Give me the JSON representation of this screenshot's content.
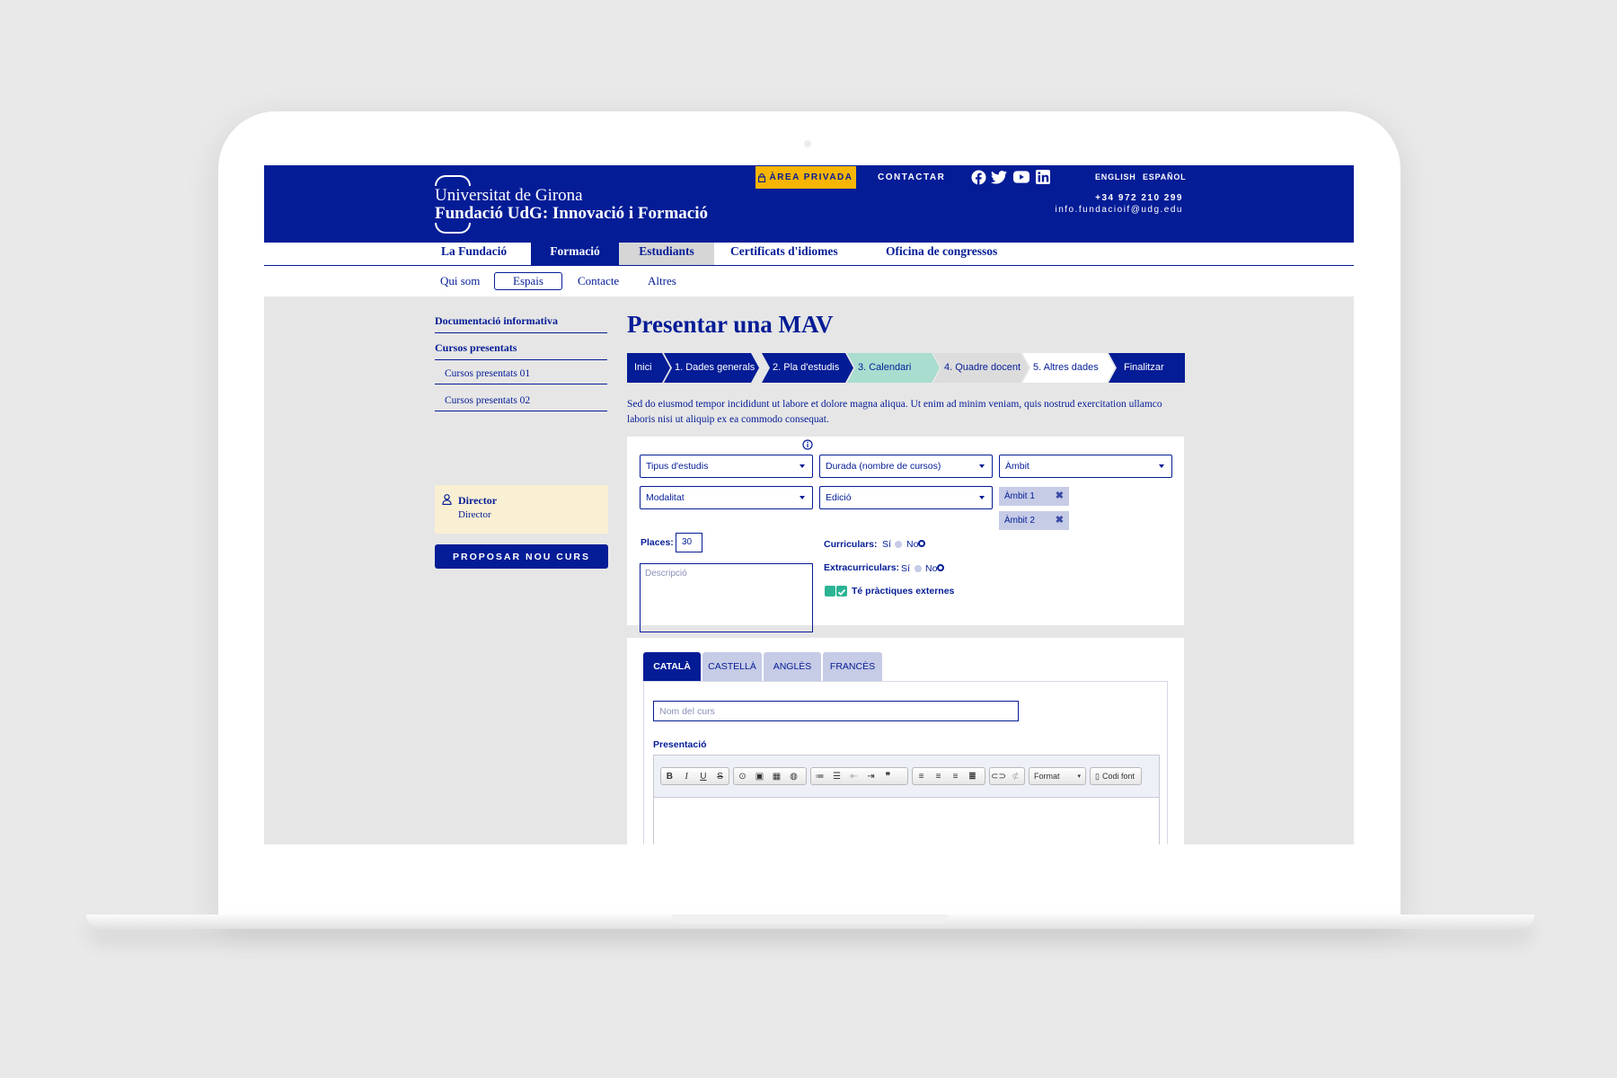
{
  "brand": {
    "line1": "Universitat de Girona",
    "line2": "Fundació UdG: Innovació i Formació"
  },
  "topbar": {
    "private_area": "ÀREA PRIVADA",
    "contact": "CONTACTAR",
    "languages": [
      "ENGLISH",
      "ESPAÑOL"
    ],
    "phone": "+34 972 210 299",
    "email": "info.fundacioif@udg.edu",
    "social_icons": [
      "facebook-icon",
      "twitter-icon",
      "youtube-icon",
      "linkedin-icon"
    ]
  },
  "main_nav": [
    "La Fundació",
    "Formació",
    "Estudiants",
    "Certificats d'idiomes",
    "Oficina de congressos"
  ],
  "sub_nav": [
    "Qui som",
    "Espais",
    "Contacte",
    "Altres"
  ],
  "sidebar": {
    "links": [
      "Documentació informativa",
      "Cursos presentats",
      "Cursos presentats 01",
      "Cursos presentats 02"
    ],
    "director_title": "Director",
    "director_role": "Director",
    "propose_button": "PROPOSAR NOU CURS"
  },
  "page": {
    "title": "Presentar una MAV",
    "steps": [
      "Inici",
      "1. Dades generals",
      "2. Pla d'estudis",
      "3. Calendari",
      "4. Quadre docent",
      "5. Altres dades",
      "Finalitzar"
    ],
    "intro": "Sed do eiusmod tempor incididunt ut labore et dolore magna aliqua. Ut enim ad minim veniam, quis nostrud exercitation ullamco laboris nisi ut aliquip ex ea commodo consequat."
  },
  "form": {
    "selects": [
      "Tipus d'estudis",
      "Durada (nombre de cursos)",
      "Àmbit",
      "Modalitat",
      "Edició"
    ],
    "tags": [
      "Àmbit 1",
      "Àmbit 2"
    ],
    "places_label": "Places:",
    "places_value": "30",
    "description_placeholder": "Descripció",
    "curriculars_label": "Curriculars:",
    "extracurriculars_label": "Extracurriculars:",
    "yes": "Sí",
    "no": "No",
    "practices_label": "Té pràctiques externes"
  },
  "lang_tabs": [
    "CATALÀ",
    "CASTELLÀ",
    "ANGLÈS",
    "FRANCÈS"
  ],
  "course": {
    "name_placeholder": "Nom del curs",
    "presentation_label": "Presentació",
    "format_label": "Format",
    "source_label": "Codi font"
  },
  "colors": {
    "primary": "#041c96",
    "accent": "#f7b500",
    "step_active": "#a9ddd0",
    "check": "#2bb594"
  }
}
